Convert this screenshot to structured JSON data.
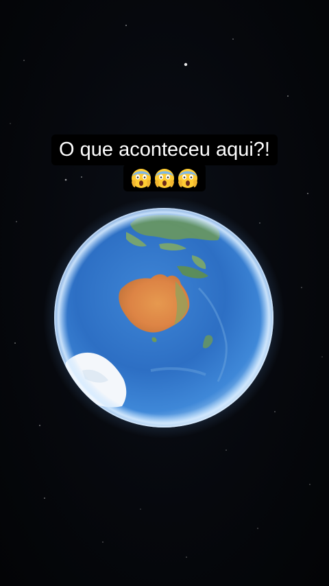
{
  "caption": {
    "text": "O que aconteceu aqui?!",
    "emoji_count": 3,
    "emoji_icon": "face-screaming-in-fear-icon"
  },
  "colors": {
    "space": "#05070b",
    "ocean": "#2f74c9",
    "ocean_deep": "#1e56a8",
    "atmosphere": "#bfe0ff",
    "australia": "#e08a4a",
    "land_green": "#6e9e58",
    "ice": "#f4f7fb",
    "caption_bg": "#000000",
    "caption_text": "#ffffff"
  }
}
